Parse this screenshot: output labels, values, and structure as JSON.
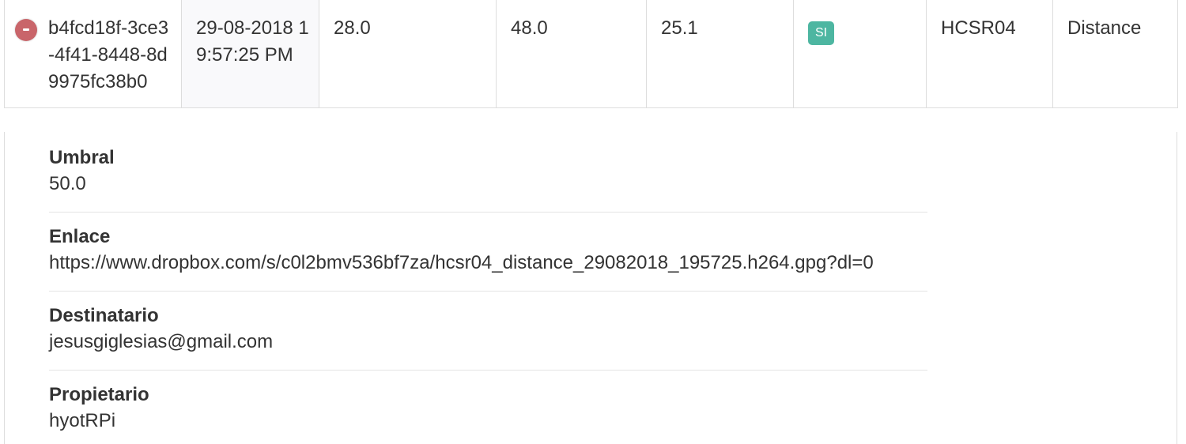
{
  "row": {
    "id": "b4fcd18f-3ce3-4f41-8448-8d9975fc38b0",
    "date": "29-08-2018 19:57:25 PM",
    "value_1": "28.0",
    "value_2": "48.0",
    "value_3": "25.1",
    "badge": "SI",
    "sensor": "HCSR04",
    "type": "Distance"
  },
  "details": [
    {
      "title": "Umbral",
      "value": "50.0"
    },
    {
      "title": "Enlace",
      "value": "https://www.dropbox.com/s/c0l2bmv536bf7za/hcsr04_distance_29082018_195725.h264.gpg?dl=0"
    },
    {
      "title": "Destinatario",
      "value": "jesusgiglesias@gmail.com"
    },
    {
      "title": "Propietario",
      "value": "hyotRPi"
    }
  ],
  "colors": {
    "collapse_button": "#c9656a",
    "badge": "#4db6a1"
  }
}
